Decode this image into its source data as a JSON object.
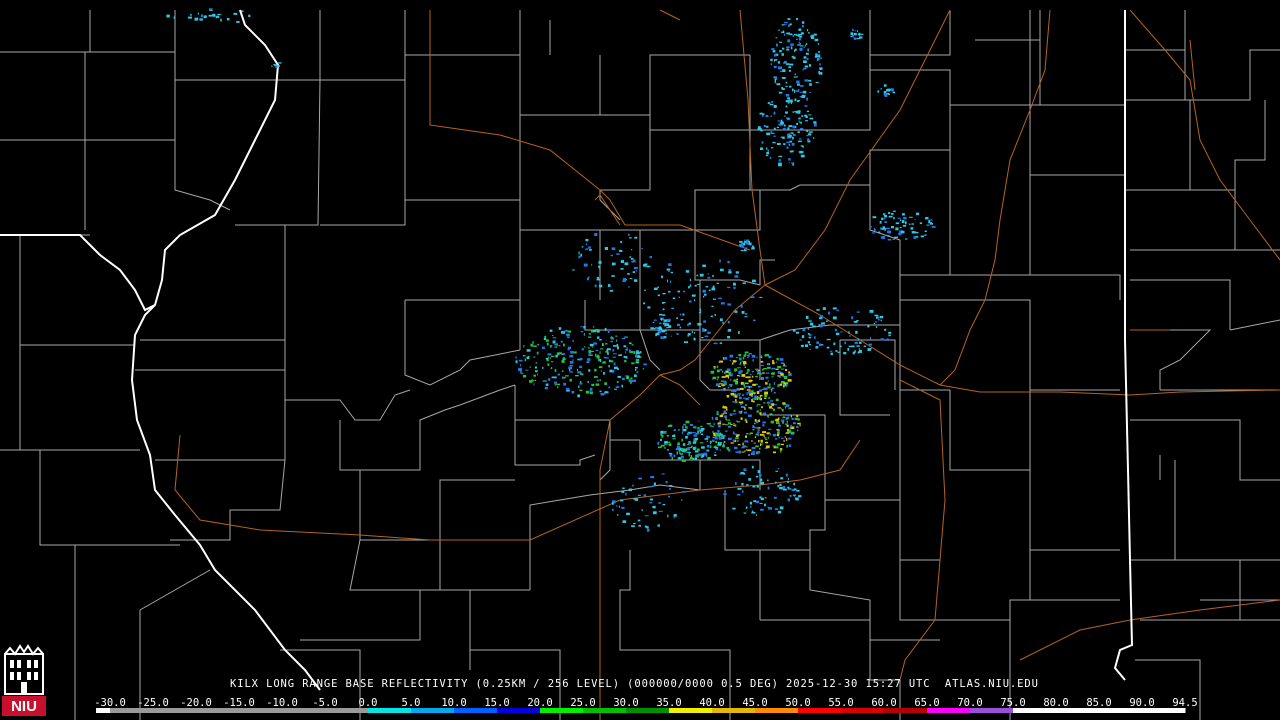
{
  "product": {
    "title": "KILX LONG RANGE BASE REFLECTIVITY (0.25KM / 256 LEVEL) (000000/0000 0.5 DEG) 2025-12-30 15:27 UTC  ATLAS.NIU.EDU"
  },
  "logo": {
    "text": "NIU",
    "icon": "niu-castle-icon"
  },
  "colorbar": {
    "labels": [
      "-30.0",
      "-25.0",
      "-20.0",
      "-15.0",
      "-10.0",
      "-5.0",
      "0.0",
      "5.0",
      "10.0",
      "15.0",
      "20.0",
      "25.0",
      "30.0",
      "35.0",
      "40.0",
      "45.0",
      "50.0",
      "55.0",
      "60.0",
      "65.0",
      "70.0",
      "75.0",
      "80.0",
      "85.0",
      "90.0",
      "94.5"
    ],
    "colors": [
      "#9a9a9a",
      "#9a9a9a",
      "#9a9a9a",
      "#9a9a9a",
      "#9a9a9a",
      "#9a9a9a",
      "#00e6e6",
      "#00a8f0",
      "#0060ff",
      "#0000d8",
      "#00f000",
      "#00c000",
      "#009000",
      "#f0f000",
      "#e6b800",
      "#ff8c00",
      "#ff0000",
      "#d60000",
      "#b40000",
      "#ff00ff",
      "#9a50d8",
      "#ffffff",
      "#ffffff",
      "#ffffff"
    ]
  },
  "map_colors": {
    "background": "#000000",
    "county_lines": "#a8a8a8",
    "state_lines": "#ffffff",
    "highways": "#b5651d",
    "echo_light": "#2ec8e6",
    "echo_medium": "#1f7ae8",
    "echo_strong": "#22c33a",
    "echo_core": "#e6c800"
  }
}
